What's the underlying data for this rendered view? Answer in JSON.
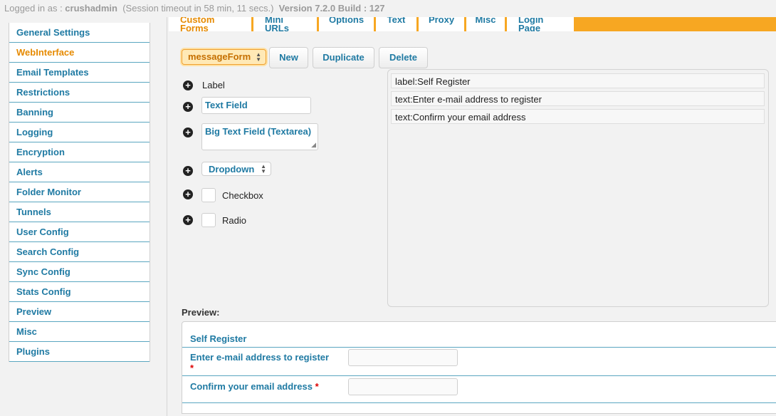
{
  "topbar": {
    "logged_in_prefix": "Logged in as : ",
    "username": "crushadmin",
    "session": "(Session timeout in 58 min, 11 secs.)",
    "version": "Version 7.2.0 Build : 127"
  },
  "sidebar": {
    "items": [
      {
        "label": "General Settings"
      },
      {
        "label": "WebInterface"
      },
      {
        "label": "Email Templates"
      },
      {
        "label": "Restrictions"
      },
      {
        "label": "Banning"
      },
      {
        "label": "Logging"
      },
      {
        "label": "Encryption"
      },
      {
        "label": "Alerts"
      },
      {
        "label": "Folder Monitor"
      },
      {
        "label": "Tunnels"
      },
      {
        "label": "User Config"
      },
      {
        "label": "Search Config"
      },
      {
        "label": "Sync Config"
      },
      {
        "label": "Stats Config"
      },
      {
        "label": "Preview"
      },
      {
        "label": "Misc"
      },
      {
        "label": "Plugins"
      }
    ],
    "active_index": 1
  },
  "tabs": [
    {
      "label": "Custom Forms"
    },
    {
      "label": "Mini URLs"
    },
    {
      "label": "Options"
    },
    {
      "label": "Text"
    },
    {
      "label": "Proxy"
    },
    {
      "label": "Misc"
    },
    {
      "label": "Login Page"
    }
  ],
  "toolbar": {
    "selected_form": "messageForm",
    "new_label": "New",
    "duplicate_label": "Duplicate",
    "delete_label": "Delete"
  },
  "palette": {
    "label": "Label",
    "text_field": "Text Field",
    "big_text_field": "Big Text Field (Textarea)",
    "dropdown": "Dropdown",
    "checkbox": "Checkbox",
    "radio": "Radio"
  },
  "form_fields": [
    {
      "text": "label:Self Register"
    },
    {
      "text": "text:Enter e-mail address to register"
    },
    {
      "text": "text:Confirm your email address"
    }
  ],
  "preview": {
    "title": "Preview:",
    "heading": "Self Register",
    "field1_label": "Enter e-mail address to register",
    "field2_label": "Confirm your email address",
    "required_mark": "*"
  },
  "colors": {
    "accent": "#f7a722",
    "link": "#1f7aa3",
    "active": "#e68a00",
    "required": "#dd0000"
  }
}
